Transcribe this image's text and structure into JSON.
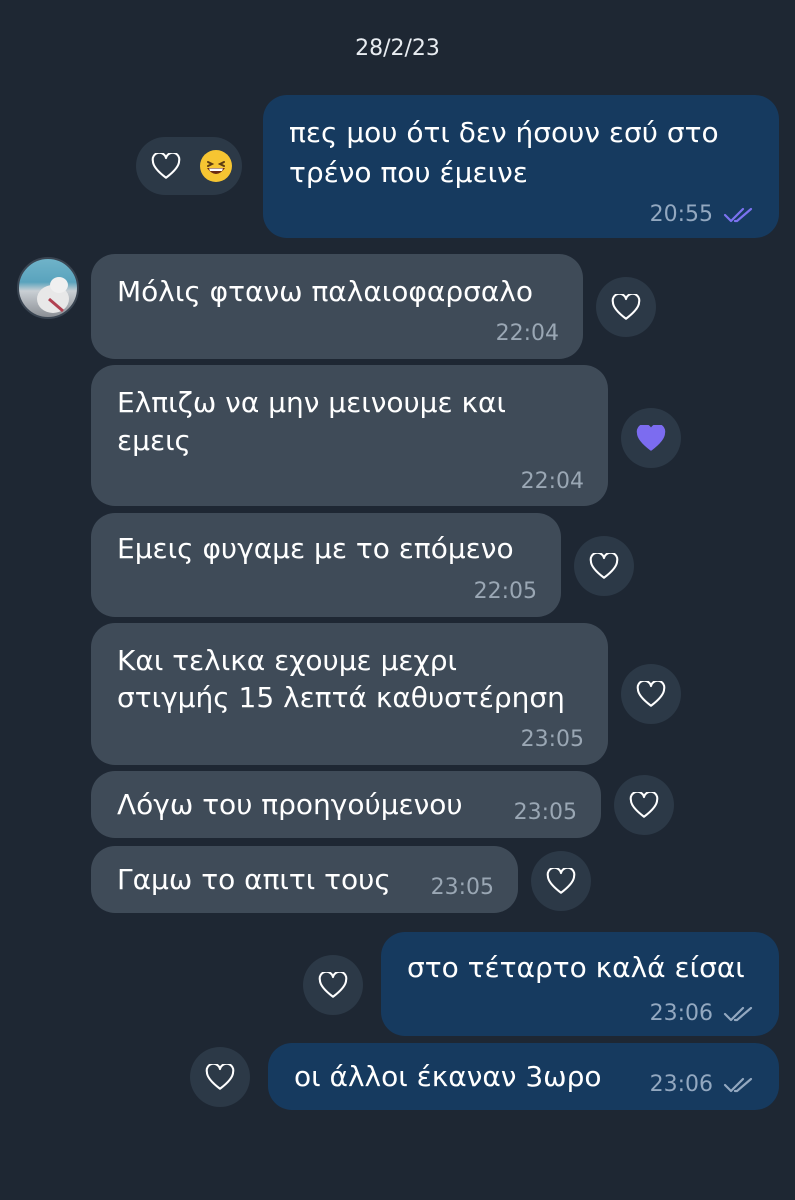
{
  "date_separator": "28/2/23",
  "messages": [
    {
      "id": "m1",
      "direction": "out",
      "lines": [
        "πες μου ότι δεν ήσουν εσύ στο",
        "τρένο που έμεινε"
      ],
      "time": "20:55",
      "read": true,
      "reaction": "laughing-emoji"
    },
    {
      "id": "m2",
      "direction": "in",
      "lines": [
        "Μόλις φτανω παλαιοφαρσαλο"
      ],
      "time": "22:04",
      "liked": false
    },
    {
      "id": "m3",
      "direction": "in",
      "lines": [
        "Ελπιζω να μην μεινουμε και",
        "εμεις"
      ],
      "time": "22:04",
      "liked": true
    },
    {
      "id": "m4",
      "direction": "in",
      "lines": [
        "Εμεις φυγαμε με το επόμενο"
      ],
      "time": "22:05",
      "liked": false
    },
    {
      "id": "m5",
      "direction": "in",
      "lines": [
        "Και τελικα εχουμε μεχρι",
        "στιγμής 15 λεπτά καθυστέρηση"
      ],
      "time": "23:05",
      "liked": false
    },
    {
      "id": "m6",
      "direction": "in",
      "lines": [
        "Λόγω του προηγούμενου"
      ],
      "time": "23:05",
      "liked": false
    },
    {
      "id": "m7",
      "direction": "in",
      "lines": [
        "Γαμω το απιτι τους"
      ],
      "time": "23:05",
      "liked": false
    },
    {
      "id": "m8",
      "direction": "out",
      "lines": [
        "στο τέταρτο καλά είσαι"
      ],
      "time": "23:06",
      "read": false
    },
    {
      "id": "m9",
      "direction": "out",
      "lines": [
        "οι άλλοι έκαναν 3ωρο"
      ],
      "time": "23:06",
      "read": false
    }
  ],
  "colors": {
    "background": "#1e2733",
    "outgoing_bubble": "#163a5f",
    "incoming_bubble": "#3f4b58",
    "liked_heart": "#7c6cf0",
    "read_ticks": "#7b72f0",
    "unread_ticks": "#93a8c0"
  },
  "icons": {
    "like": "heart-outline-icon",
    "liked": "heart-filled-icon",
    "read_status": "double-check-icon",
    "sender": "avatar"
  }
}
